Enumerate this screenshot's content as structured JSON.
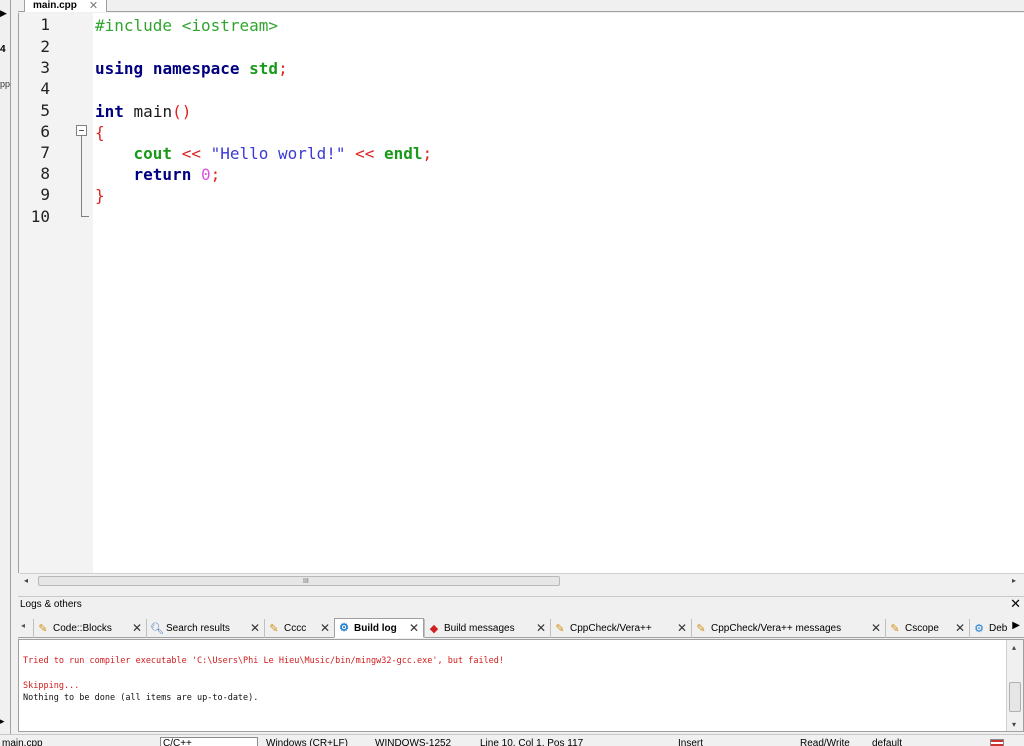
{
  "left_panel": {
    "arrow": "▶",
    "label1": "4",
    "label2": "pp",
    "label3": "▸"
  },
  "editor": {
    "tab_label": "main.cpp",
    "tab_close": "✕",
    "line_numbers": [
      "1",
      "2",
      "3",
      "4",
      "5",
      "6",
      "7",
      "8",
      "9",
      "10"
    ],
    "code": {
      "line1": "#include <iostream>",
      "line3_kw1": "using",
      "line3_kw2": "namespace",
      "line3_id": "std",
      "line3_semi": ";",
      "line5_type": "int",
      "line5_id": "main",
      "line5_paren": "()",
      "line6": "{",
      "line7_cout": "cout",
      "line7_op1": "<<",
      "line7_str": "\"Hello world!\"",
      "line7_op2": "<<",
      "line7_endl": "endl",
      "line7_semi": ";",
      "line8_kw": "return",
      "line8_num": "0",
      "line8_semi": ";",
      "line9": "}"
    },
    "hscroll_grip": "III",
    "hscroll_left": "◂",
    "hscroll_right": "▸"
  },
  "logs": {
    "title": "Logs & others",
    "close": "✕",
    "scroll_left": "◂",
    "scroll_right": "▶",
    "tabs": [
      {
        "label": "Code::Blocks",
        "icon": "note-icon"
      },
      {
        "label": "Search results",
        "icon": "search-icon"
      },
      {
        "label": "Cccc",
        "icon": "note-icon"
      },
      {
        "label": "Build log",
        "icon": "gear-icon"
      },
      {
        "label": "Build messages",
        "icon": "pin-icon"
      },
      {
        "label": "CppCheck/Vera++",
        "icon": "note-icon"
      },
      {
        "label": "CppCheck/Vera++ messages",
        "icon": "note-icon"
      },
      {
        "label": "Cscope",
        "icon": "note-icon"
      },
      {
        "label": "Deb",
        "icon": "gear-icon"
      }
    ],
    "tab_close": "✕",
    "active_tab": "Build log",
    "lines": {
      "error": "Tried to run compiler executable 'C:\\Users\\Phi Le Hieu\\Music/bin/mingw32-gcc.exe', but failed!",
      "skip": "Skipping...",
      "done": "Nothing to be done (all items are up-to-date)."
    },
    "up_arrow": "▴",
    "down_arrow": "▾"
  },
  "statusbar": {
    "file": "main.cpp",
    "language": "C/C++",
    "line_endings": "Windows (CR+LF)",
    "encoding": "WINDOWS-1252",
    "position": "Line 10, Col 1, Pos 117",
    "mode": "Insert",
    "access": "Read/Write",
    "profile": "default"
  },
  "colors": {
    "keyword": "#00007f",
    "preprocessor": "#2fa52f",
    "operator": "#e01f1f",
    "string": "#3a3ad4",
    "number": "#e050e0",
    "error_text": "#d21b1b"
  }
}
